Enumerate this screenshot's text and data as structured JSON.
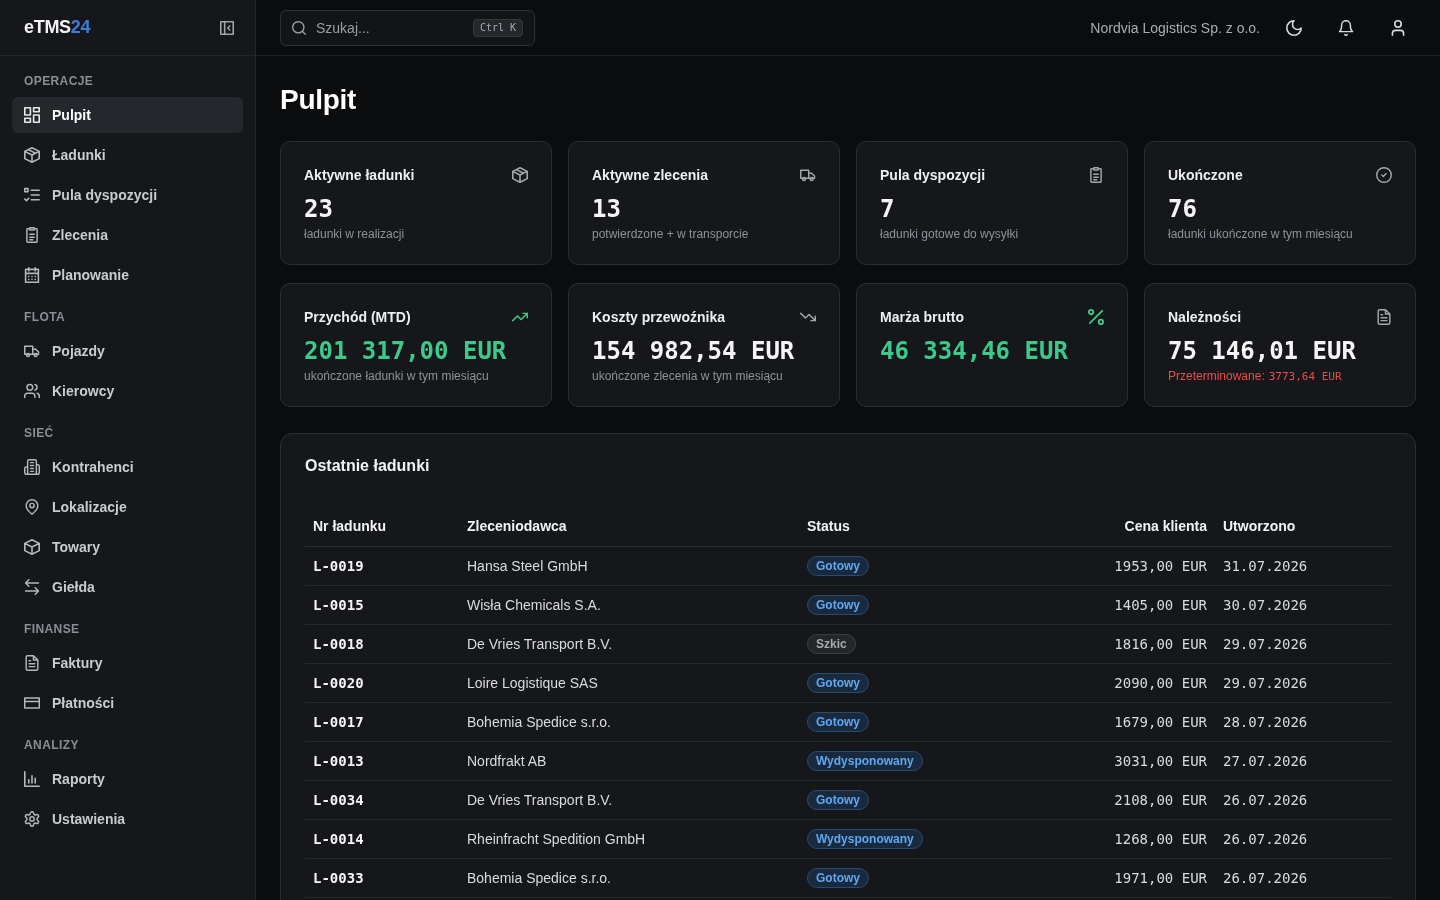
{
  "sidebar": {
    "logo": {
      "text": "eTMS",
      "accent": "24"
    },
    "groups": [
      {
        "title": "OPERACJE",
        "items": [
          {
            "label": "Pulpit",
            "selected": true
          },
          {
            "label": "Ładunki",
            "selected": false
          },
          {
            "label": "Pula dyspozycji",
            "selected": false
          },
          {
            "label": "Zlecenia",
            "selected": false
          },
          {
            "label": "Planowanie",
            "selected": false
          }
        ]
      },
      {
        "title": "FLOTA",
        "items": [
          {
            "label": "Pojazdy",
            "selected": false
          },
          {
            "label": "Kierowcy",
            "selected": false
          }
        ]
      },
      {
        "title": "SIEĆ",
        "items": [
          {
            "label": "Kontrahenci",
            "selected": false
          },
          {
            "label": "Lokalizacje",
            "selected": false
          },
          {
            "label": "Towary",
            "selected": false
          },
          {
            "label": "Giełda",
            "selected": false
          }
        ]
      },
      {
        "title": "FINANSE",
        "items": [
          {
            "label": "Faktury",
            "selected": false
          },
          {
            "label": "Płatności",
            "selected": false
          }
        ]
      },
      {
        "title": "ANALIZY",
        "items": [
          {
            "label": "Raporty",
            "selected": false
          },
          {
            "label": "Ustawienia",
            "selected": false
          }
        ]
      }
    ]
  },
  "header": {
    "search": {
      "placeholder": "Szukaj...",
      "shortcut": "Ctrl K"
    },
    "company": "Nordvia Logistics Sp. z o.o."
  },
  "page": {
    "title": "Pulpit"
  },
  "stats": [
    {
      "title": "Aktywne ładunki",
      "value": "23",
      "subtitle": "ładunki w realizacji",
      "positive": false
    },
    {
      "title": "Aktywne zlecenia",
      "value": "13",
      "subtitle": "potwierdzone + w transporcie",
      "positive": false
    },
    {
      "title": "Pula dyspozycji",
      "value": "7",
      "subtitle": "ładunki gotowe do wysyłki",
      "positive": false
    },
    {
      "title": "Ukończone",
      "value": "76",
      "subtitle": "ładunki ukończone w tym miesiącu",
      "positive": false
    },
    {
      "title": "Przychód (MTD)",
      "value": "201 317,00 EUR",
      "subtitle": "ukończone ładunki w tym miesiącu",
      "positive": true
    },
    {
      "title": "Koszty przewoźnika",
      "value": "154 982,54 EUR",
      "subtitle": "ukończone zlecenia w tym miesiącu",
      "positive": false
    },
    {
      "title": "Marża brutto",
      "value": "46 334,46 EUR",
      "positive": true
    },
    {
      "title": "Należności",
      "value": "75 146,01 EUR",
      "note": {
        "label": "Przeterminowane:",
        "amount": "3773,64 EUR"
      },
      "positive": false
    }
  ],
  "recent": {
    "title": "Ostatnie ładunki",
    "columns": [
      "Nr ładunku",
      "Zleceniodawca",
      "Status",
      "Cena klienta",
      "Utworzono"
    ],
    "rows": [
      {
        "id": "L-0019",
        "client": "Hansa Steel GmbH",
        "status": {
          "label": "Gotowy",
          "kind": "info"
        },
        "price": "1953,00 EUR",
        "created": "31.07.2026"
      },
      {
        "id": "L-0015",
        "client": "Wisła Chemicals S.A.",
        "status": {
          "label": "Gotowy",
          "kind": "info"
        },
        "price": "1405,00 EUR",
        "created": "30.07.2026"
      },
      {
        "id": "L-0018",
        "client": "De Vries Transport B.V.",
        "status": {
          "label": "Szkic",
          "kind": "neutral"
        },
        "price": "1816,00 EUR",
        "created": "29.07.2026"
      },
      {
        "id": "L-0020",
        "client": "Loire Logistique SAS",
        "status": {
          "label": "Gotowy",
          "kind": "info"
        },
        "price": "2090,00 EUR",
        "created": "29.07.2026"
      },
      {
        "id": "L-0017",
        "client": "Bohemia Spedice s.r.o.",
        "status": {
          "label": "Gotowy",
          "kind": "info"
        },
        "price": "1679,00 EUR",
        "created": "28.07.2026"
      },
      {
        "id": "L-0013",
        "client": "Nordfrakt AB",
        "status": {
          "label": "Wydysponowany",
          "kind": "info"
        },
        "price": "3031,00 EUR",
        "created": "27.07.2026"
      },
      {
        "id": "L-0034",
        "client": "De Vries Transport B.V.",
        "status": {
          "label": "Gotowy",
          "kind": "info"
        },
        "price": "2108,00 EUR",
        "created": "26.07.2026"
      },
      {
        "id": "L-0014",
        "client": "Rheinfracht Spedition GmbH",
        "status": {
          "label": "Wydysponowany",
          "kind": "info"
        },
        "price": "1268,00 EUR",
        "created": "26.07.2026"
      },
      {
        "id": "L-0033",
        "client": "Bohemia Spedice s.r.o.",
        "status": {
          "label": "Gotowy",
          "kind": "info"
        },
        "price": "1971,00 EUR",
        "created": "26.07.2026"
      }
    ]
  }
}
